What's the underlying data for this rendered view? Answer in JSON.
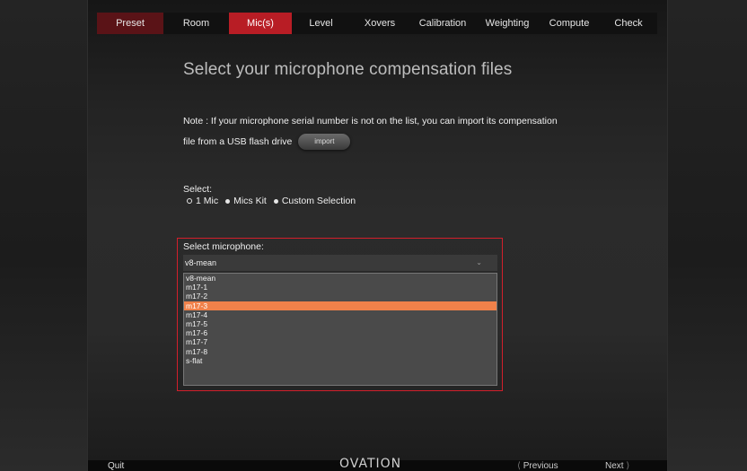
{
  "nav": {
    "tabs": [
      {
        "label": "Preset"
      },
      {
        "label": "Room"
      },
      {
        "label": "Mic(s)"
      },
      {
        "label": "Level"
      },
      {
        "label": "Xovers"
      },
      {
        "label": "Calibration"
      },
      {
        "label": "Weighting"
      },
      {
        "label": "Compute"
      },
      {
        "label": "Check"
      }
    ],
    "active_index": 2
  },
  "page": {
    "title": "Select your microphone compensation files",
    "note_line1": "Note : If your microphone serial number is not on the list, you can import its compensation",
    "note_line2": "file from a USB flash drive",
    "import_label": "import"
  },
  "select": {
    "label": "Select:",
    "options": [
      {
        "label": "1 Mic",
        "selected": true
      },
      {
        "label": "Mics Kit",
        "selected": false
      },
      {
        "label": "Custom Selection",
        "selected": false
      }
    ]
  },
  "microphone": {
    "label": "Select microphone:",
    "current_value": "v8-mean",
    "options": [
      "v8-mean",
      "m17-1",
      "m17-2",
      "m17-3",
      "m17-4",
      "m17-5",
      "m17-6",
      "m17-7",
      "m17-8",
      "s-flat"
    ],
    "highlighted_index": 3
  },
  "footer": {
    "quit_label": "Quit",
    "logo_text": "OVATION",
    "previous_label": "Previous",
    "previous_arrow": "⟨",
    "next_label": "Next",
    "next_arrow": "⟩"
  },
  "colors": {
    "accent_red": "#b81d25",
    "preset_dark_red": "#5a1317",
    "highlight_orange": "#f0814a",
    "panel_border_red": "#d21f2b"
  }
}
